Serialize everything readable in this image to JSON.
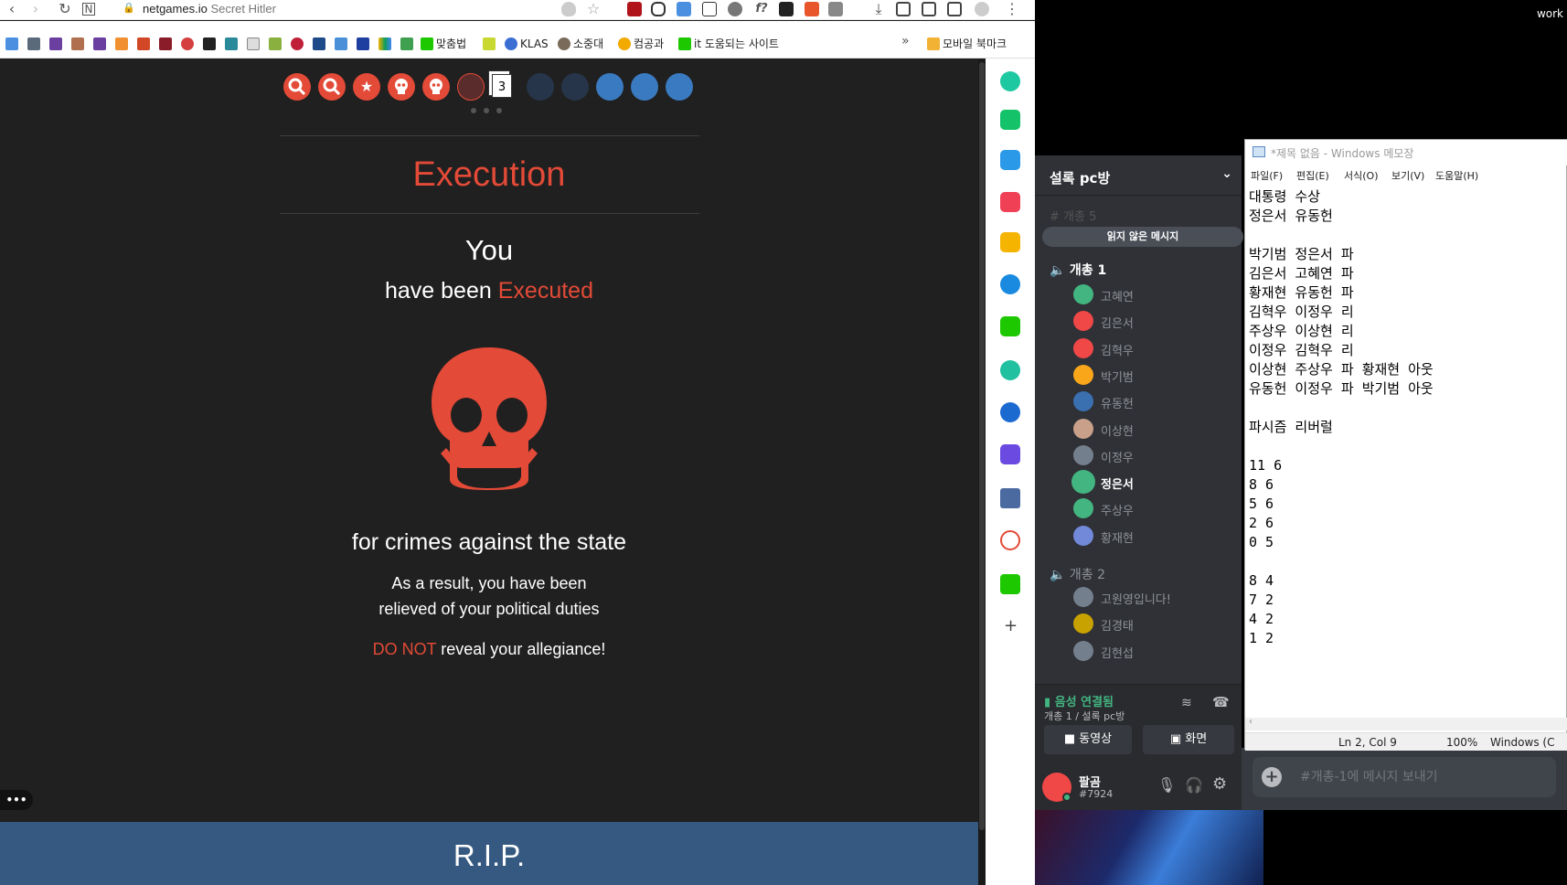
{
  "browser": {
    "url_domain": "netgames.io",
    "url_title": "Secret Hitler",
    "lock_glyph": "🔒",
    "bookmarks_overflow": "»",
    "bookmarks": [
      {
        "label": "맞춤법",
        "color": "#1ec800"
      },
      {
        "label": "KLAS",
        "color": "#3b6fd4"
      },
      {
        "label": "소중대",
        "color": "#7a6a5a"
      },
      {
        "label": "컴공과",
        "color": "#f2a900"
      },
      {
        "label": "it 도움되는 사이트",
        "color": "#1ec800"
      },
      {
        "label": "모바일 북마크",
        "color": "#f2b233"
      }
    ]
  },
  "game": {
    "track_value": "3",
    "title": "Execution",
    "you": "You",
    "have_been": "have been",
    "executed": "Executed",
    "crimes": "for crimes against the state",
    "result1": "As a result, you have been",
    "result2": "relieved of your political duties",
    "do_not": "DO NOT",
    "reveal": "reveal your allegiance!",
    "rip": "R.I.P.",
    "more": "•••"
  },
  "discord": {
    "server_name": "설록 pc방",
    "unread_pill": "읽지 않은 메시지",
    "hidden_channel": "# 개총 5",
    "voice_channel_1": "개총 1",
    "voice_channel_2": "개총 2",
    "members_1": [
      {
        "name": "고혜연",
        "color": "#43b581",
        "active": false
      },
      {
        "name": "김은서",
        "color": "#f04747",
        "active": false
      },
      {
        "name": "김혁우",
        "color": "#f04747",
        "active": false
      },
      {
        "name": "박기범",
        "color": "#faa61a",
        "active": false
      },
      {
        "name": "유동헌",
        "color": "#3a6fb0",
        "active": false
      },
      {
        "name": "이상현",
        "color": "#c9a08a",
        "active": false
      },
      {
        "name": "이정우",
        "color": "#747f8d",
        "active": false
      },
      {
        "name": "정은서",
        "color": "#43b581",
        "active": true
      },
      {
        "name": "주상우",
        "color": "#43b581",
        "active": false
      },
      {
        "name": "황재현",
        "color": "#7289da",
        "active": false
      }
    ],
    "members_2": [
      {
        "name": "고원영입니다!",
        "color": "#747f8d"
      },
      {
        "name": "김경태",
        "color": "#c8a200"
      },
      {
        "name": "김현섭",
        "color": "#747f8d"
      }
    ],
    "voice_connected": "음성 연결됨",
    "voice_location": "개총 1 / 설록 pc방",
    "video_button": "동영상",
    "screen_button": "화면",
    "username": "팔곰",
    "user_tag": "#7924",
    "chat_placeholder": "#개총-1에 메시지 보내기",
    "corner_text": "work"
  },
  "notepad": {
    "title": "*제목 없음 - Windows 메모장",
    "menu": [
      "파일(F)",
      "편집(E)",
      "서식(O)",
      "보기(V)",
      "도움말(H)"
    ],
    "content": "대통령 수상\n정은서 유동헌\n\n박기범 정은서 파\n김은서 고혜연 파\n황재현 유동헌 파\n김혁우 이정우 리\n주상우 이상현 리\n이정우 김혁우 리\n이상현 주상우 파 황재현 아웃\n유동헌 이정우 파 박기범 아웃\n\n파시즘 리버럴\n\n11 6\n8 6\n5 6\n2 6\n0 5\n\n8 4\n7 2\n4 2\n1 2",
    "status_pos": "Ln 2, Col 9",
    "status_zoom": "100%",
    "status_eol": "Windows (C"
  }
}
